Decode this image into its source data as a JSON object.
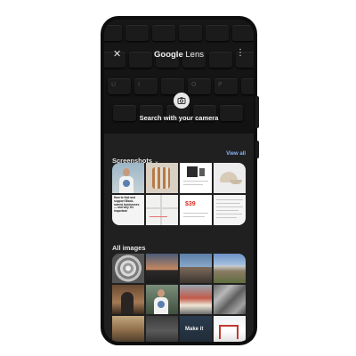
{
  "header": {
    "title_brand": "Google",
    "title_product": "Lens",
    "close_icon": "close-icon",
    "more_icon": "more-vert-icon"
  },
  "camera": {
    "hint": "Search with your camera",
    "shutter_icon": "image-search-icon"
  },
  "keyboard": {
    "row1": [
      "",
      "",
      "",
      "",
      ""
    ],
    "row3": [
      "U",
      "I",
      "O",
      "P"
    ]
  },
  "screenshots": {
    "title": "Screenshots",
    "view_all": "View all",
    "text_tile": "How to find and support Black-owned businesses — and why it's important",
    "red_text": "$39"
  },
  "all_images": {
    "title": "All images",
    "sign_text": "Make it"
  },
  "colors": {
    "accent": "#8ab4f8",
    "sheet_bg": "#202020",
    "phone_body": "#0d0d0d"
  }
}
